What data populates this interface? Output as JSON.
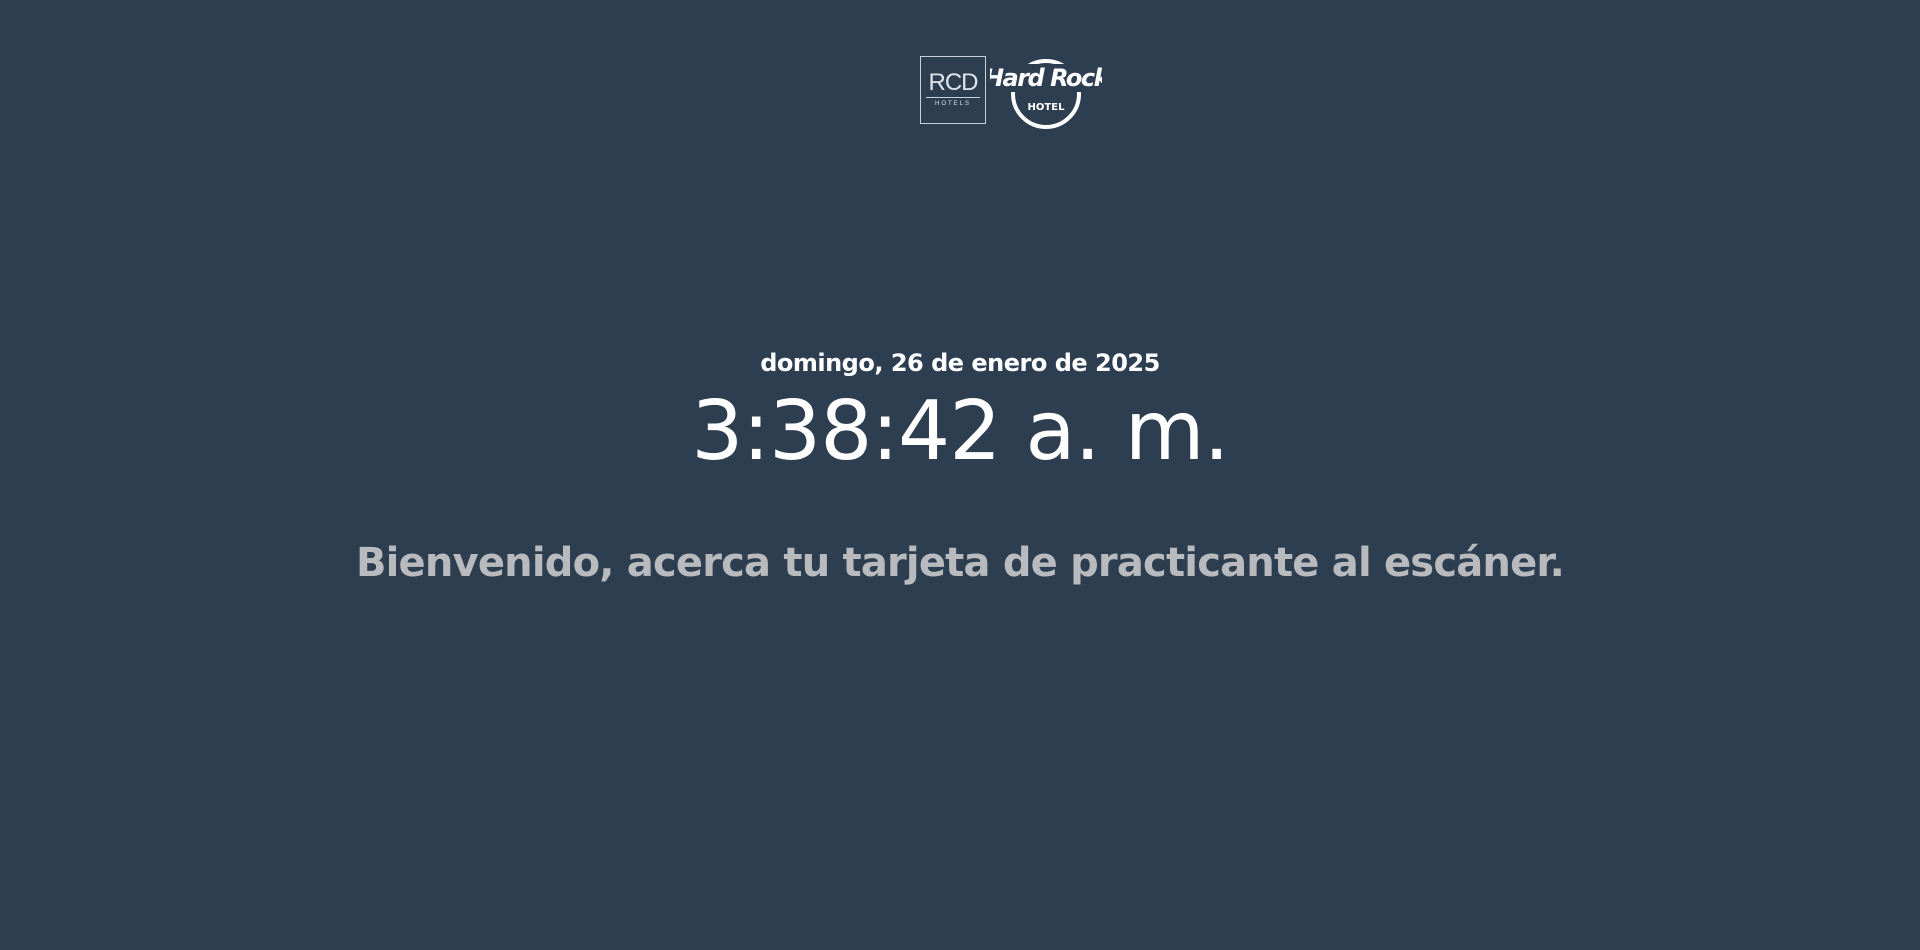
{
  "brand": {
    "rcd_main": "RCD",
    "rcd_sub": "HOTELS",
    "hardrock_main": "Hard Rock",
    "hardrock_sub": "HOTEL"
  },
  "kiosk": {
    "date": "domingo, 26 de enero de 2025",
    "time": "3:38:42 a. m.",
    "welcome_message": "Bienvenido, acerca tu tarjeta de practicante al escáner."
  },
  "colors": {
    "background": "#2e3e51",
    "primary_text": "#ffffff",
    "secondary_text": "#b8babd"
  }
}
